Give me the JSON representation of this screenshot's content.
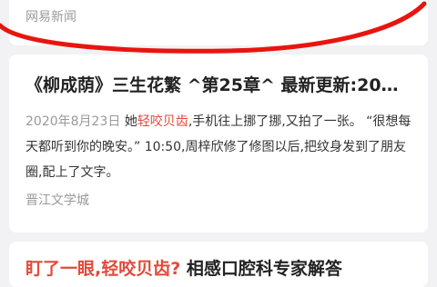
{
  "cards": [
    {
      "source": "网易新闻"
    },
    {
      "title": "《柳成荫》三生花繁 ^第25章^ 最新更新:20…",
      "snippet_date": "2020年8月23日",
      "snippet_pre": "她",
      "snippet_highlight": "轻咬贝齿",
      "snippet_post": ",手机往上挪了挪,又拍了一张。 “很想每天都听到你的晚安。” 10:50,周梓欣修了修图以后,把纹身发到了朋友圈,配上了文字。",
      "source": "晋江文学城"
    },
    {
      "title_highlight": "盯了一眼,轻咬贝齿?",
      "title_rest": " 相感口腔科专家解答"
    }
  ],
  "annotation_color": "#e8150e"
}
